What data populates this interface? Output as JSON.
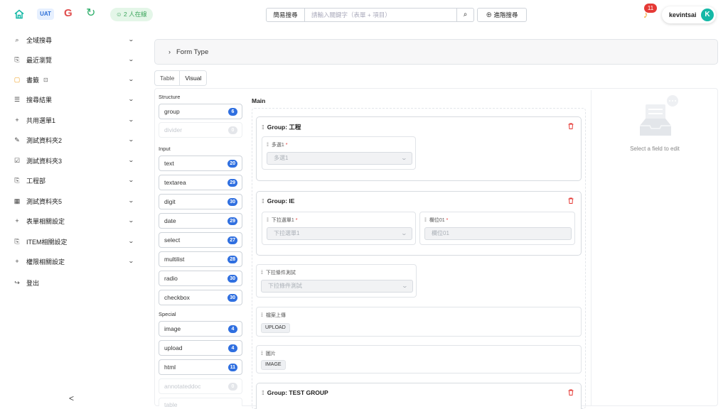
{
  "topbar": {
    "env_badge": "UAT",
    "online_text": "2 人在線",
    "search_mode": "簡易搜尋",
    "search_placeholder": "請輸入關鍵字（表單 + 項目）",
    "advanced_search": "進階搜尋",
    "notification_count": "11",
    "username": "kevintsai",
    "avatar_letter": "K"
  },
  "sidebar": {
    "items": [
      {
        "icon": "search-icon",
        "label": "全域搜尋"
      },
      {
        "icon": "history-icon",
        "label": "最近瀏覽"
      },
      {
        "icon": "bookmark-icon",
        "label": "書籤"
      },
      {
        "icon": "list-icon",
        "label": "搜尋結果"
      },
      {
        "icon": "plus-icon",
        "label": "共用選單1"
      },
      {
        "icon": "edit-icon",
        "label": "測試資料夾2"
      },
      {
        "icon": "checkbox-icon",
        "label": "測試資料夾3"
      },
      {
        "icon": "copy-icon",
        "label": "工程部"
      },
      {
        "icon": "table-icon",
        "label": "測試資料夾5"
      },
      {
        "icon": "plus-icon",
        "label": "表單相關設定"
      },
      {
        "icon": "copy-icon",
        "label": "ITEM相關設定"
      },
      {
        "icon": "plus-icon",
        "label": "權限相關設定"
      },
      {
        "icon": "logout-icon",
        "label": "登出"
      }
    ],
    "collapse": "<"
  },
  "form_type": "Form Type",
  "tabs": [
    "Table",
    "Visual"
  ],
  "palette": {
    "structure_label": "Structure",
    "input_label": "Input",
    "special_label": "Special",
    "structure": [
      {
        "name": "group",
        "count": "6",
        "disabled": false
      },
      {
        "name": "divider",
        "count": "0",
        "disabled": true
      }
    ],
    "input": [
      {
        "name": "text",
        "count": "20",
        "disabled": false
      },
      {
        "name": "textarea",
        "count": "29",
        "disabled": false
      },
      {
        "name": "digit",
        "count": "30",
        "disabled": false
      },
      {
        "name": "date",
        "count": "29",
        "disabled": false
      },
      {
        "name": "select",
        "count": "27",
        "disabled": false
      },
      {
        "name": "multilist",
        "count": "28",
        "disabled": false
      },
      {
        "name": "radio",
        "count": "30",
        "disabled": false
      },
      {
        "name": "checkbox",
        "count": "30",
        "disabled": false
      }
    ],
    "special": [
      {
        "name": "image",
        "count": "4",
        "disabled": false
      },
      {
        "name": "upload",
        "count": "4",
        "disabled": false
      },
      {
        "name": "html",
        "count": "11",
        "disabled": false
      },
      {
        "name": "annotateddoc",
        "count": "0",
        "disabled": true
      },
      {
        "name": "table",
        "count": "0",
        "disabled": true
      }
    ]
  },
  "main": {
    "title": "Main",
    "group1": {
      "title": "Group: 工程",
      "field_label": "多選1",
      "field_value": "多選1"
    },
    "group2": {
      "title": "Group: IE",
      "field1_label": "下拉選單1",
      "field1_value": "下拉選單1",
      "field2_label": "欄位01",
      "field2_value": "欄位01"
    },
    "loose_select": {
      "label": "下拉條件測試",
      "value": "下拉條件測試"
    },
    "upload": {
      "label": "檔案上傳",
      "tag": "UPLOAD"
    },
    "image": {
      "label": "圖片",
      "tag": "IMAGE"
    },
    "group3": {
      "title": "Group: TEST GROUP"
    }
  },
  "inspector": {
    "empty_text": "Select a field to edit"
  },
  "colors": {
    "accent": "#2f6fe0",
    "danger": "#e53935",
    "online": "#3ca55c"
  }
}
